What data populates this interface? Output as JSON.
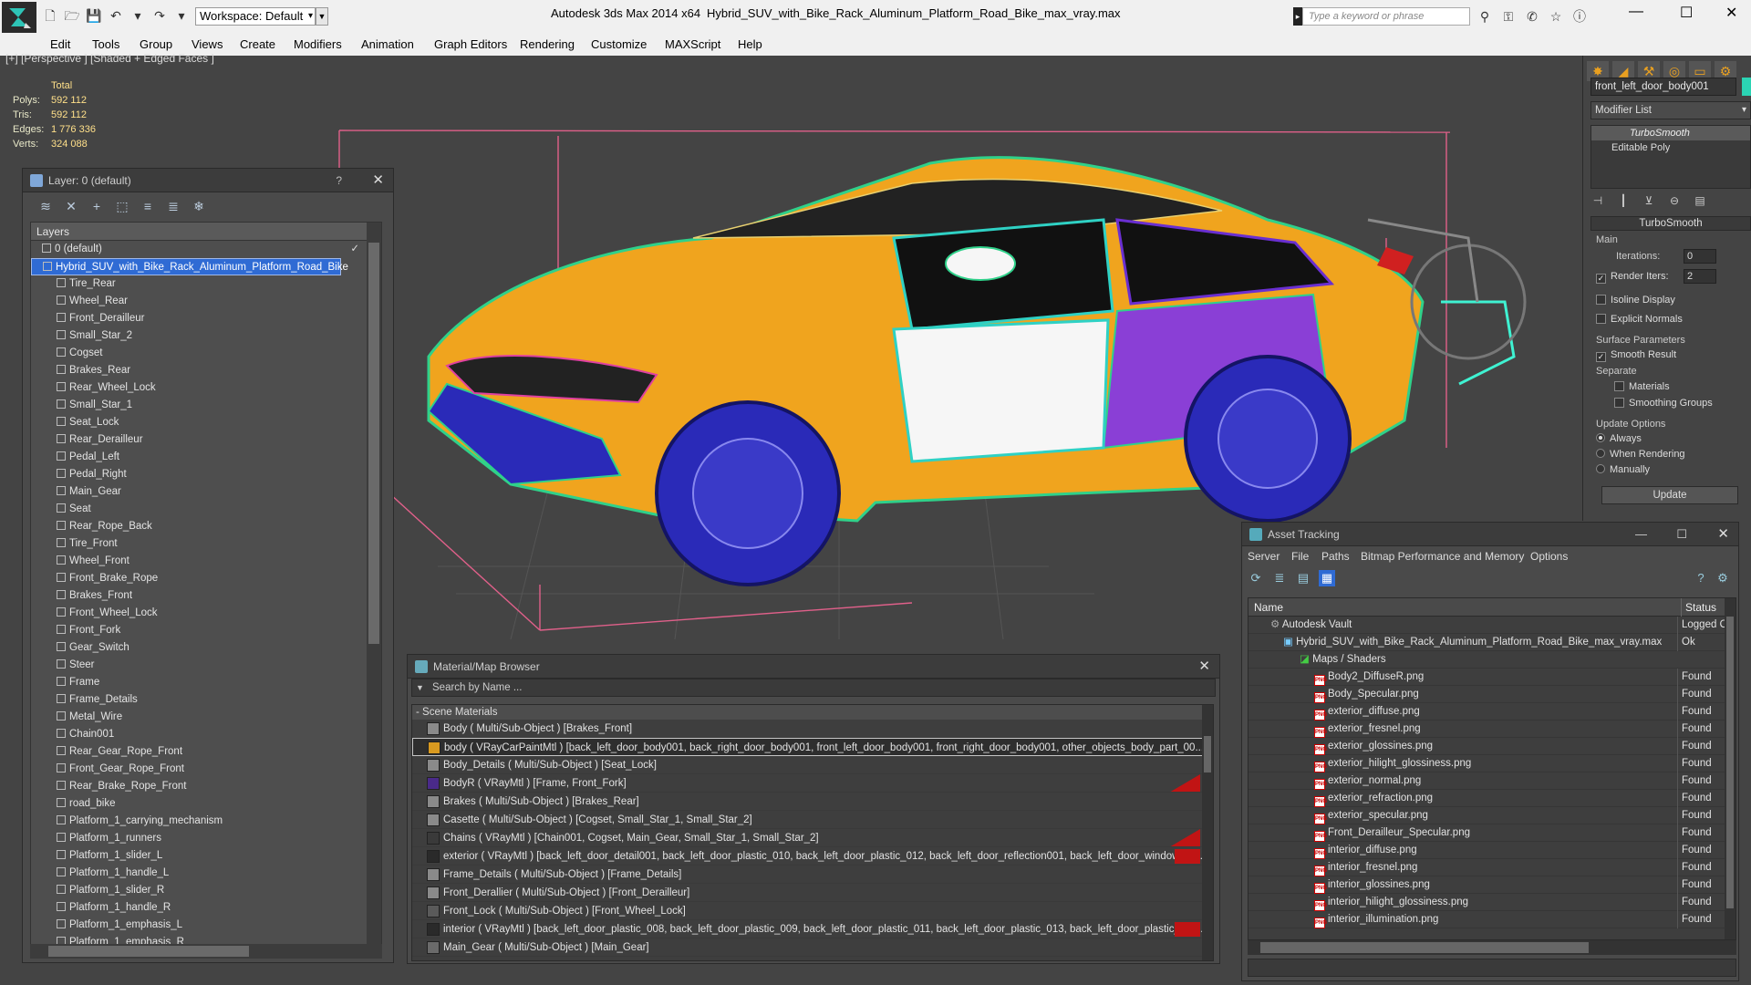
{
  "titlebar": {
    "workspace": "Workspace: Default",
    "app_title": "Autodesk 3ds Max  2014 x64",
    "file_title": "Hybrid_SUV_with_Bike_Rack_Aluminum_Platform_Road_Bike_max_vray.max",
    "search_placeholder": "Type a keyword or phrase"
  },
  "menubar": [
    "Edit",
    "Tools",
    "Group",
    "Views",
    "Create",
    "Modifiers",
    "Animation",
    "Graph Editors",
    "Rendering",
    "Customize",
    "MAXScript",
    "Help"
  ],
  "viewport": {
    "label": "[+] [Perspective ] [Shaded + Edged Faces ]",
    "stats": {
      "header": "Total",
      "rows": [
        {
          "k": "Polys:",
          "v": "592 112"
        },
        {
          "k": "Tris:",
          "v": "592 112"
        },
        {
          "k": "Edges:",
          "v": "1 776 336"
        },
        {
          "k": "Verts:",
          "v": "324 088"
        }
      ]
    }
  },
  "layer_dialog": {
    "title": "Layer: 0 (default)",
    "help": "?",
    "header": "Layers",
    "default_layer": "0 (default)",
    "selected_layer": "Hybrid_SUV_with_Bike_Rack_Aluminum_Platform_Road_Bike",
    "items": [
      "Tire_Rear",
      "Wheel_Rear",
      "Front_Derailleur",
      "Small_Star_2",
      "Cogset",
      "Brakes_Rear",
      "Rear_Wheel_Lock",
      "Small_Star_1",
      "Seat_Lock",
      "Rear_Derailleur",
      "Pedal_Left",
      "Pedal_Right",
      "Main_Gear",
      "Seat",
      "Rear_Rope_Back",
      "Tire_Front",
      "Wheel_Front",
      "Front_Brake_Rope",
      "Brakes_Front",
      "Front_Wheel_Lock",
      "Front_Fork",
      "Gear_Switch",
      "Steer",
      "Frame",
      "Frame_Details",
      "Metal_Wire",
      "Chain001",
      "Rear_Gear_Rope_Front",
      "Front_Gear_Rope_Front",
      "Rear_Brake_Rope_Front",
      "road_bike",
      "Platform_1_carrying_mechanism",
      "Platform_1_runners",
      "Platform_1_slider_L",
      "Platform_1_handle_L",
      "Platform_1_slider_R",
      "Platform_1_handle_R",
      "Platform_1_emphasis_L",
      "Platform_1_emphasis_R"
    ]
  },
  "command_panel": {
    "object_name": "front_left_door_body001",
    "modifier_list": "Modifier List",
    "stack": [
      "TurboSmooth",
      "Editable Poly"
    ],
    "rollout": "TurboSmooth",
    "main_label": "Main",
    "iterations_label": "Iterations:",
    "iterations_value": "0",
    "render_iters_label": "Render Iters:",
    "render_iters_value": "2",
    "isoline": "Isoline Display",
    "explicit": "Explicit Normals",
    "surface_params": "Surface Parameters",
    "smooth_result": "Smooth Result",
    "separate": "Separate",
    "materials": "Materials",
    "smoothing_groups": "Smoothing Groups",
    "update_options": "Update Options",
    "always": "Always",
    "when_rendering": "When Rendering",
    "manually": "Manually",
    "update_btn": "Update"
  },
  "material_browser": {
    "title": "Material/Map Browser",
    "search_placeholder": "Search by Name ...",
    "group": "- Scene Materials",
    "rows": [
      {
        "text": "Body  ( Multi/Sub-Object )  [Brakes_Front]",
        "color": "#8a8a8a"
      },
      {
        "text": "body  ( VRayCarPaintMtl )  [back_left_door_body001, back_right_door_body001, front_left_door_body001, front_right_door_body001, other_objects_body_part_00...",
        "color": "#d99a20"
      },
      {
        "text": "Body_Details  ( Multi/Sub-Object )  [Seat_Lock]",
        "color": "#8a8a8a"
      },
      {
        "text": "BodyR  ( VRayMtl )  [Frame, Front_Fork]",
        "color": "#4a2a8a"
      },
      {
        "text": "Brakes  ( Multi/Sub-Object )  [Brakes_Rear]",
        "color": "#8a8a8a"
      },
      {
        "text": "Casette  ( Multi/Sub-Object )  [Cogset, Small_Star_1, Small_Star_2]",
        "color": "#8a8a8a"
      },
      {
        "text": "Chains  ( VRayMtl )  [Chain001, Cogset, Main_Gear, Small_Star_1, Small_Star_2]",
        "color": "#3a3a3a"
      },
      {
        "text": "exterior  ( VRayMtl )  [back_left_door_detail001, back_left_door_plastic_010, back_left_door_plastic_012, back_left_door_reflection001, back_left_door_window001...",
        "color": "#2a2a2a"
      },
      {
        "text": "Frame_Details  ( Multi/Sub-Object )  [Frame_Details]",
        "color": "#8a8a8a"
      },
      {
        "text": "Front_Derallier  ( Multi/Sub-Object )  [Front_Derailleur]",
        "color": "#8a8a8a"
      },
      {
        "text": "Front_Lock  ( Multi/Sub-Object )  [Front_Wheel_Lock]",
        "color": "#5a5a5a"
      },
      {
        "text": "interior  ( VRayMtl )  [back_left_door_plastic_008, back_left_door_plastic_009, back_left_door_plastic_011, back_left_door_plastic_013, back_left_door_plastic_014...",
        "color": "#2a2a2a"
      },
      {
        "text": "Main_Gear  ( Multi/Sub-Object )  [Main_Gear]",
        "color": "#6a6a6a"
      }
    ]
  },
  "asset_tracking": {
    "title": "Asset Tracking",
    "menu": [
      "Server",
      "File",
      "Paths",
      "Bitmap Performance and Memory",
      "Options"
    ],
    "col_name": "Name",
    "col_status": "Status",
    "vault": {
      "name": "Autodesk Vault",
      "status": "Logged O"
    },
    "file": {
      "name": "Hybrid_SUV_with_Bike_Rack_Aluminum_Platform_Road_Bike_max_vray.max",
      "status": "Ok"
    },
    "maps_group": "Maps / Shaders",
    "maps": [
      {
        "name": "Body2_DiffuseR.png",
        "status": "Found"
      },
      {
        "name": "Body_Specular.png",
        "status": "Found"
      },
      {
        "name": "exterior_diffuse.png",
        "status": "Found"
      },
      {
        "name": "exterior_fresnel.png",
        "status": "Found"
      },
      {
        "name": "exterior_glossines.png",
        "status": "Found"
      },
      {
        "name": "exterior_hilight_glossiness.png",
        "status": "Found"
      },
      {
        "name": "exterior_normal.png",
        "status": "Found"
      },
      {
        "name": "exterior_refraction.png",
        "status": "Found"
      },
      {
        "name": "exterior_specular.png",
        "status": "Found"
      },
      {
        "name": "Front_Derailleur_Specular.png",
        "status": "Found"
      },
      {
        "name": "interior_diffuse.png",
        "status": "Found"
      },
      {
        "name": "interior_fresnel.png",
        "status": "Found"
      },
      {
        "name": "interior_glossines.png",
        "status": "Found"
      },
      {
        "name": "interior_hilight_glossiness.png",
        "status": "Found"
      },
      {
        "name": "interior_illumination.png",
        "status": "Found"
      }
    ]
  }
}
